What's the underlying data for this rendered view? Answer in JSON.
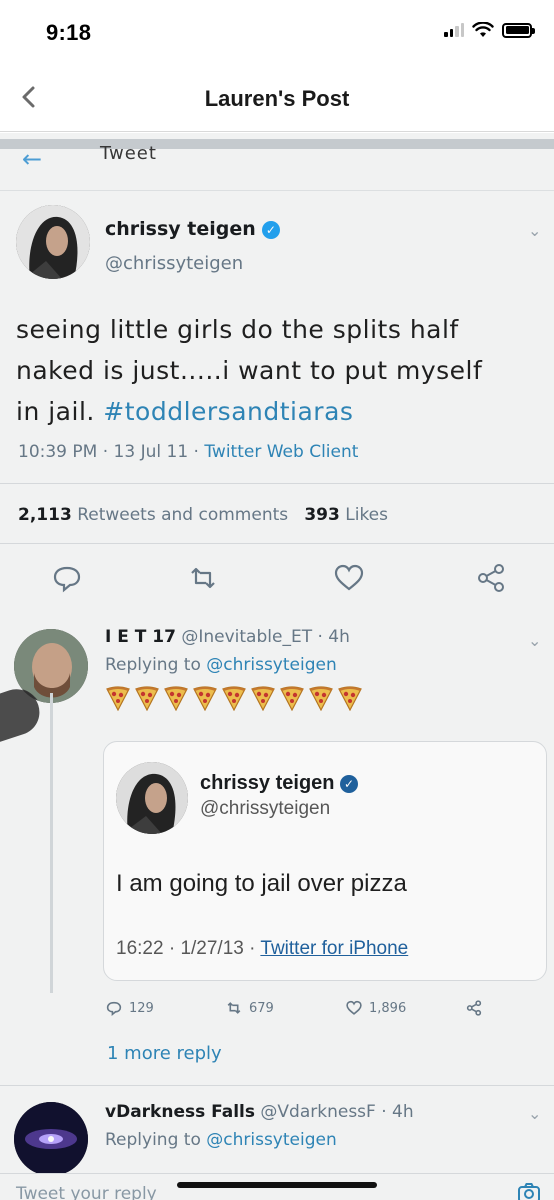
{
  "status_bar": {
    "time": "9:18"
  },
  "nav": {
    "title": "Lauren's Post"
  },
  "tweet_header": {
    "label": "Tweet"
  },
  "main_tweet": {
    "name": "chrissy teigen",
    "handle": "@chrissyteigen",
    "text_line1": "seeing little girls do the splits half",
    "text_line2": "naked is just.....i want to put myself",
    "text_line3_prefix": "in jail.",
    "hashtag": "#toddlersandtiaras",
    "time": "10:39 PM",
    "date": "13 Jul 11",
    "client": "Twitter Web Client",
    "retweets_count": "2,113",
    "retweets_label": "Retweets and comments",
    "likes_count": "393",
    "likes_label": "Likes"
  },
  "reply_1": {
    "name": "I E T 17",
    "handle": "@Inevitable_ET",
    "age": "4h",
    "replying_prefix": "Replying to",
    "replying_to": "@chrissyteigen",
    "pizza_count": 9,
    "quote": {
      "name": "chrissy teigen",
      "handle": "@chrissyteigen",
      "text": "I am going to jail over pizza",
      "time": "16:22",
      "date": "1/27/13",
      "client": "Twitter for iPhone"
    },
    "replies": "129",
    "retweets": "679",
    "likes": "1,896",
    "more_reply": "1 more reply"
  },
  "reply_2": {
    "name": "vDarkness Falls",
    "handle": "@VdarknessF",
    "age": "4h",
    "replying_prefix": "Replying to",
    "replying_to": "@chrissyteigen"
  },
  "compose": {
    "placeholder": "Tweet your reply"
  },
  "colors": {
    "link": "#2a84b8",
    "verified": "#1da1f2"
  }
}
